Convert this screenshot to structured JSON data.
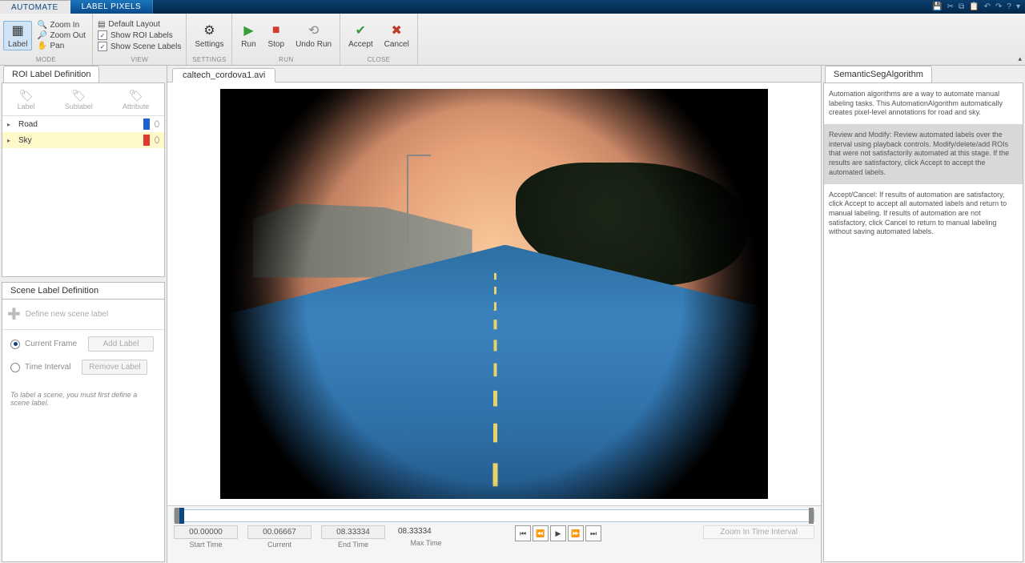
{
  "menubar": {
    "tabs": [
      {
        "label": "AUTOMATE",
        "active": true
      },
      {
        "label": "LABEL PIXELS",
        "active": false
      }
    ]
  },
  "ribbon": {
    "mode": {
      "label_btn": "Label",
      "zoom_in": "Zoom In",
      "zoom_out": "Zoom Out",
      "pan": "Pan",
      "footer": "MODE"
    },
    "view": {
      "default_layout": "Default Layout",
      "show_roi": "Show ROI Labels",
      "show_scene": "Show Scene Labels",
      "footer": "VIEW"
    },
    "settings": {
      "btn": "Settings",
      "footer": "SETTINGS"
    },
    "run": {
      "run": "Run",
      "stop": "Stop",
      "undo": "Undo Run",
      "footer": "RUN"
    },
    "close": {
      "accept": "Accept",
      "cancel": "Cancel",
      "footer": "CLOSE"
    }
  },
  "roi_panel": {
    "title": "ROI Label Definition",
    "toolbar": {
      "label": "Label",
      "sublabel": "Sublabel",
      "attribute": "Attribute"
    },
    "labels": [
      {
        "name": "Road",
        "color": "#1e5fd6",
        "selected": false
      },
      {
        "name": "Sky",
        "color": "#e03a2f",
        "selected": true
      }
    ]
  },
  "scene_panel": {
    "title": "Scene Label Definition",
    "define_hint": "Define new scene label",
    "current_frame": "Current Frame",
    "time_interval": "Time Interval",
    "add_label": "Add Label",
    "remove_label": "Remove Label",
    "hint": "To label a scene, you must first define a scene label."
  },
  "viewer": {
    "tab": "caltech_cordova1.avi"
  },
  "timeline": {
    "start_val": "00.00000",
    "start_lbl": "Start Time",
    "current_val": "00.06667",
    "current_lbl": "Current",
    "end_val": "08.33334",
    "end_lbl": "End Time",
    "max_val": "08.33334",
    "max_lbl": "Max Time",
    "zoom_btn": "Zoom In Time Interval"
  },
  "algo_panel": {
    "title": "SemanticSegAlgorithm",
    "p1": "Automation algorithms are a way to automate manual labeling tasks. This AutomationAlgorithm automatically creates pixel-level annotations for road and sky.",
    "p2": "Review and Modify: Review automated labels over the interval using playback controls. Modify/delete/add ROIs that were not satisfactorily automated at this stage. If the results are satisfactory, click Accept to accept the automated labels.",
    "p3": "Accept/Cancel: If results of automation are satisfactory, click Accept to accept all automated labels and return to manual labeling. If results of automation are not satisfactory, click Cancel to return to manual labeling without saving automated labels."
  }
}
